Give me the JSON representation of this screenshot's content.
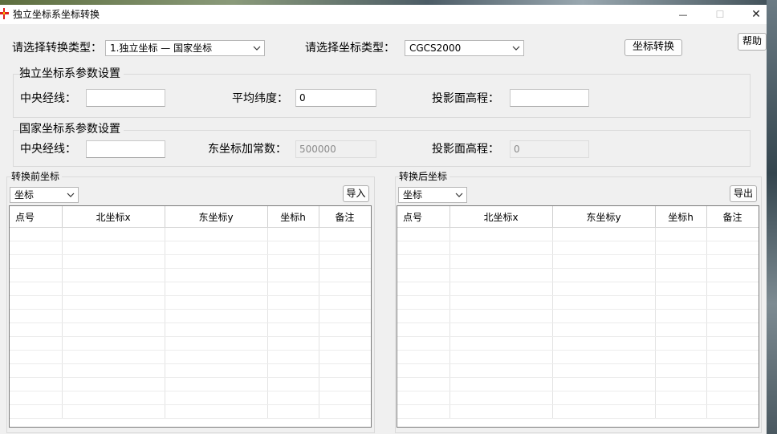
{
  "window": {
    "title": "独立坐标系坐标转换",
    "controls": {
      "minimize": "—",
      "maximize": "☐",
      "close": "✕"
    }
  },
  "top": {
    "conversion_type_label": "请选择转换类型：",
    "conversion_type_value": "1.独立坐标 — 国家坐标",
    "coord_type_label": "请选择坐标类型：",
    "coord_type_value": "CGCS2000",
    "convert_button": "坐标转换",
    "help_button": "帮助"
  },
  "independent": {
    "group_title": "独立坐标系参数设置",
    "central_meridian_label": "中央经线：",
    "central_meridian_value": "",
    "mean_latitude_label": "平均纬度：",
    "mean_latitude_value": "0",
    "projection_height_label": "投影面高程：",
    "projection_height_value": ""
  },
  "national": {
    "group_title": "国家坐标系参数设置",
    "central_meridian_label": "中央经线：",
    "central_meridian_value": "",
    "false_easting_label": "东坐标加常数：",
    "false_easting_value": "500000",
    "projection_height_label": "投影面高程：",
    "projection_height_value": "0"
  },
  "before": {
    "group_title": "转换前坐标",
    "format_value": "坐标",
    "import_button": "导入",
    "columns": [
      "点号",
      "北坐标x",
      "东坐标y",
      "坐标h",
      "备注"
    ]
  },
  "after": {
    "group_title": "转换后坐标",
    "format_value": "坐标",
    "export_button": "导出",
    "columns": [
      "点号",
      "北坐标x",
      "东坐标y",
      "坐标h",
      "备注"
    ]
  },
  "colors": {
    "window_bg": "#f0f0f0",
    "titlebar_bg": "#ffffff",
    "icon_red": "#e02020",
    "icon_yellow": "#f5c400"
  }
}
